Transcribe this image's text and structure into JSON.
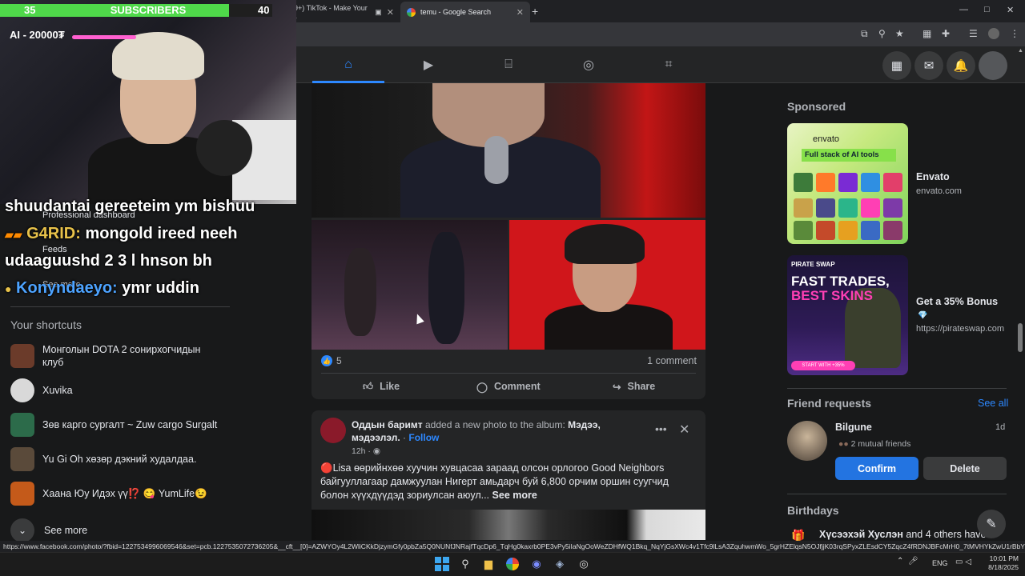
{
  "browser": {
    "tabs": [
      {
        "label": "(99+) TikTok - Make Your Da"
      },
      {
        "label": "temu - Google Search"
      }
    ],
    "new_tab": "+",
    "window_controls": {
      "minimize": "—",
      "maximize": "□",
      "close": "✕"
    }
  },
  "stream_overlay": {
    "subs_now": "35",
    "subs_label": "SUBSCRIBERS",
    "subs_goal": "40",
    "subs_progress": 0.84,
    "ai_tag": "AI - 20000₮",
    "chat": [
      {
        "name": "",
        "text": "shuudantai gereeteim ym bishuu"
      },
      {
        "name": "G4RID:",
        "text": "mongold ireed neeh"
      },
      {
        "name": "",
        "text": "udaaguushd 2 3 l hnson bh"
      },
      {
        "name": "Konyndaeyo:",
        "text": "ymr uddin"
      }
    ],
    "ghost_items": {
      "dashboard": "Professional dashboard",
      "feeds": "Feeds",
      "see_more": "See more"
    }
  },
  "sidebar": {
    "shortcuts_title": "Your shortcuts",
    "shortcuts": [
      {
        "label": "Монголын DOTA 2 сонирхогчидын клуб",
        "color": "#6b3b2a"
      },
      {
        "label": "Xuvika",
        "color": "#d9d9d9"
      },
      {
        "label": "Зөв карго сургалт ~ Zuw cargo Surgalt",
        "color": "#2c6b4a"
      },
      {
        "label": "Yu Gi Oh хөзөр дэкний худалдаа.",
        "color": "#5a4a3a"
      },
      {
        "label": "Хаана Юу Идэх үү⁉️ 😋 YumLife😉",
        "color": "#c45a1a"
      }
    ],
    "see_more": "See more"
  },
  "post1": {
    "like_count": "5",
    "comments": "1 comment",
    "actions": {
      "like": "Like",
      "comment": "Comment",
      "share": "Share"
    }
  },
  "post2": {
    "author": "Оддын баримт",
    "action": "added a new photo to the album:",
    "album": "Мэдээ, мэдээлэл.",
    "follow": "Follow",
    "time": "12h ·",
    "text": "🔴Lisa өөрийнхөө хуучин хувцасаа зараад олсон орлогоо Good Neighbors байгууллагаар дамжуулан Нигерт амьдарч буй 6,800 орчим оршин суугчид болон хүүхдүүдэд зориулсан аюул...",
    "see_more": "See more",
    "more_icon": "•••",
    "close_icon": "✕"
  },
  "right": {
    "sponsored": "Sponsored",
    "ad1": {
      "brand_in_image": "envato",
      "tagline": "Full stack of AI tools",
      "name": "Envato",
      "url": "envato.com"
    },
    "ad2": {
      "brand_in_image": "PIRATE SWAP",
      "headline1": "FAST TRADES,",
      "headline2": "BEST SKINS",
      "cta": "START WITH +35%",
      "name": "Get a 35% Bonus",
      "gem": "💎",
      "url": "https://pirateswap.com"
    },
    "friend_requests": {
      "title": "Friend requests",
      "see_all": "See all",
      "name": "Bilgune",
      "time": "1d",
      "mutual": "2 mutual friends",
      "confirm": "Confirm",
      "delete": "Delete"
    },
    "birthdays": {
      "title": "Birthdays",
      "icon": "🎁",
      "name": "Хүсээхэй Хуслэн",
      "rest": "and 4 others have"
    }
  },
  "status_url": "https://www.facebook.com/photo/?fbid=1227534996069546&set=pcb.1227535072736205&__cft__[0]=AZWYOy4L2WliCKkDjzymGfy0pbZa5Q0NUNfJNRajfTqcDp6_TqHg0kaxrb0PE3vPy5iIaNgOoWeZDHfWQ1Bkq_NqYjGsXWc4v1Tfc9lLsA3ZquhwmWo_5grHZElqsN5OJfjjK03rqSPyxZLEsdCY5ZqcZ4fRDNJBFcMrH0_7tMVHYkZwU1rBbYbomMjRnr-cvwabP8B1Tz...",
  "taskbar": {
    "lang": "ENG",
    "time": "10:01 PM",
    "date": "8/18/2025"
  },
  "colors": {
    "accent": "#2d88ff",
    "confirm": "#2374e1",
    "subs_green": "#4fd84a"
  }
}
